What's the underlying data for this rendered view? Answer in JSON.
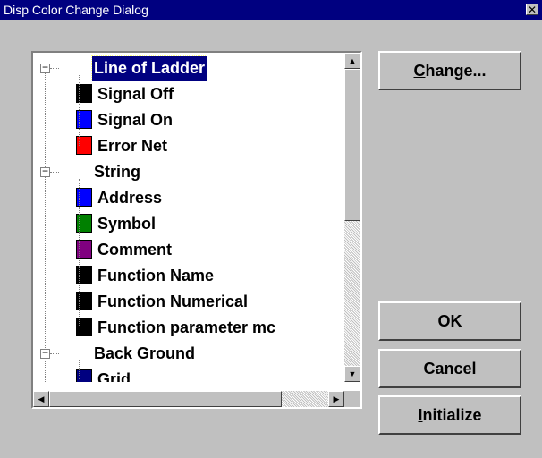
{
  "window": {
    "title": "Disp Color Change Dialog",
    "close_glyph": "✕"
  },
  "tree": {
    "groups": [
      {
        "label": "Line of Ladder",
        "selected": true,
        "items": [
          {
            "label": "Signal Off",
            "color": "#000000"
          },
          {
            "label": "Signal On",
            "color": "#0000ff"
          },
          {
            "label": "Error Net",
            "color": "#ff0000"
          }
        ]
      },
      {
        "label": "String",
        "selected": false,
        "items": [
          {
            "label": "Address",
            "color": "#0000ff"
          },
          {
            "label": "Symbol",
            "color": "#008000"
          },
          {
            "label": "Comment",
            "color": "#800080"
          },
          {
            "label": "Function Name",
            "color": "#000000"
          },
          {
            "label": "Function Numerical",
            "color": "#000000"
          },
          {
            "label": "Function parameter mc",
            "color": "#000000"
          }
        ]
      },
      {
        "label": "Back Ground",
        "selected": false,
        "items": [
          {
            "label": "Grid",
            "color": "#000080"
          }
        ]
      }
    ]
  },
  "buttons": {
    "change": {
      "mnemonic": "C",
      "rest": "hange..."
    },
    "ok": "OK",
    "cancel": "Cancel",
    "initialize": {
      "mnemonic": "I",
      "rest": "nitialize"
    }
  },
  "icons": {
    "scroll_up": "▲",
    "scroll_down": "▼",
    "scroll_left": "◀",
    "scroll_right": "▶",
    "expander": "−"
  }
}
